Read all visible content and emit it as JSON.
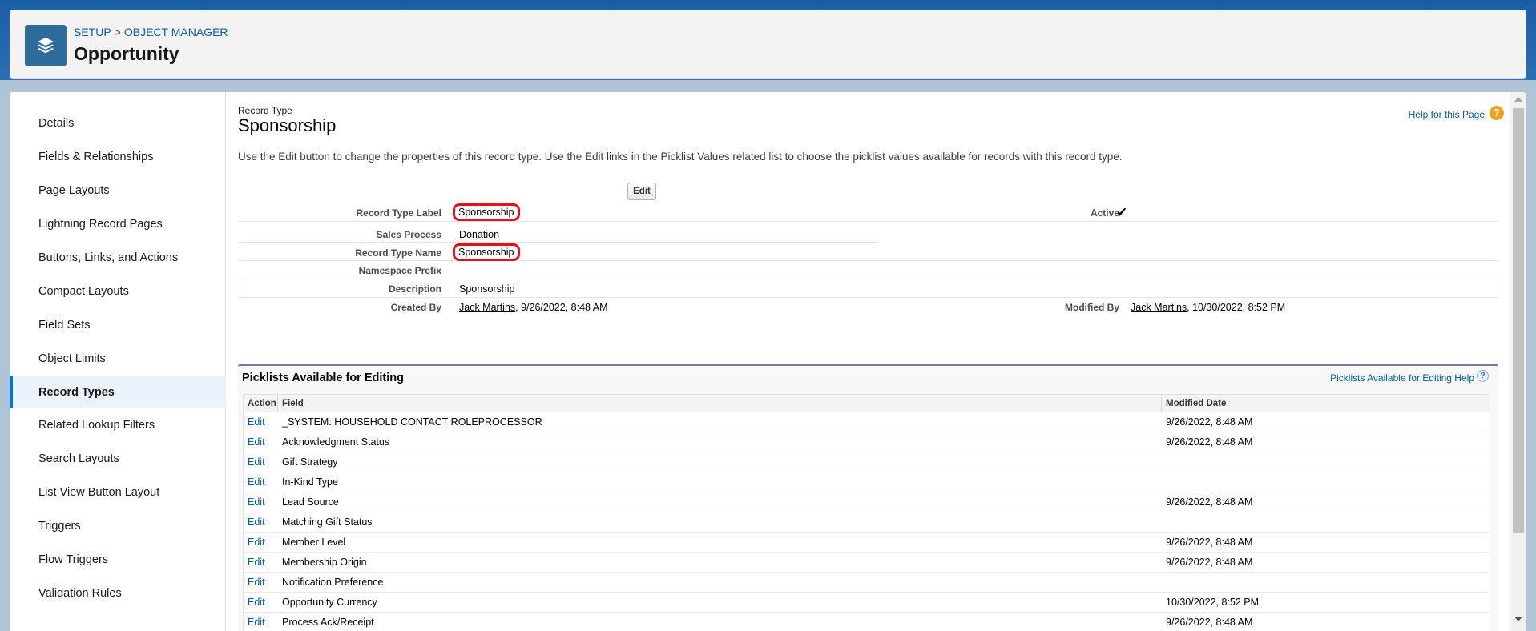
{
  "header": {
    "breadcrumb_setup": "SETUP",
    "breadcrumb_sep": ">",
    "breadcrumb_object_manager": "OBJECT MANAGER",
    "title": "Opportunity",
    "icon": "layers-icon"
  },
  "sidebar": {
    "items": [
      {
        "label": "Details"
      },
      {
        "label": "Fields & Relationships"
      },
      {
        "label": "Page Layouts"
      },
      {
        "label": "Lightning Record Pages"
      },
      {
        "label": "Buttons, Links, and Actions"
      },
      {
        "label": "Compact Layouts"
      },
      {
        "label": "Field Sets"
      },
      {
        "label": "Object Limits"
      },
      {
        "label": "Record Types"
      },
      {
        "label": "Related Lookup Filters"
      },
      {
        "label": "Search Layouts"
      },
      {
        "label": "List View Button Layout"
      },
      {
        "label": "Triggers"
      },
      {
        "label": "Flow Triggers"
      },
      {
        "label": "Validation Rules"
      }
    ],
    "active": "Record Types"
  },
  "record": {
    "kicker": "Record Type",
    "title": "Sponsorship",
    "help_link": "Help for this Page",
    "description": "Use the Edit button to change the properties of this record type. Use the Edit links in the Picklist Values related list to choose the picklist values available for records with this record type.",
    "edit_button": "Edit",
    "fields": {
      "record_type_label_label": "Record Type Label",
      "record_type_label_value": "Sponsorship",
      "active_label": "Active",
      "active_value": "✔",
      "sales_process_label": "Sales Process",
      "sales_process_value": "Donation",
      "record_type_name_label": "Record Type Name",
      "record_type_name_value": "Sponsorship",
      "namespace_prefix_label": "Namespace Prefix",
      "description_label": "Description",
      "description_value": "Sponsorship",
      "created_by_label": "Created By",
      "created_by_user": "Jack Martins",
      "created_by_date": ", 9/26/2022, 8:48 AM",
      "modified_by_label": "Modified By",
      "modified_by_user": "Jack Martins",
      "modified_by_date": ", 10/30/2022, 8:52 PM"
    }
  },
  "picklists": {
    "title": "Picklists Available for Editing",
    "help_link": "Picklists Available for Editing Help",
    "columns": [
      "Action",
      "Field",
      "Modified Date"
    ],
    "rows": [
      {
        "action": "Edit",
        "field": "_SYSTEM: HOUSEHOLD CONTACT ROLEPROCESSOR",
        "modified": "9/26/2022, 8:48 AM"
      },
      {
        "action": "Edit",
        "field": "Acknowledgment Status",
        "modified": "9/26/2022, 8:48 AM"
      },
      {
        "action": "Edit",
        "field": "Gift Strategy",
        "modified": ""
      },
      {
        "action": "Edit",
        "field": "In-Kind Type",
        "modified": ""
      },
      {
        "action": "Edit",
        "field": "Lead Source",
        "modified": "9/26/2022, 8:48 AM"
      },
      {
        "action": "Edit",
        "field": "Matching Gift Status",
        "modified": ""
      },
      {
        "action": "Edit",
        "field": "Member Level",
        "modified": "9/26/2022, 8:48 AM"
      },
      {
        "action": "Edit",
        "field": "Membership Origin",
        "modified": "9/26/2022, 8:48 AM"
      },
      {
        "action": "Edit",
        "field": "Notification Preference",
        "modified": ""
      },
      {
        "action": "Edit",
        "field": "Opportunity Currency",
        "modified": "10/30/2022, 8:52 PM"
      },
      {
        "action": "Edit",
        "field": "Process Ack/Receipt",
        "modified": "9/26/2022, 8:48 AM"
      }
    ]
  }
}
